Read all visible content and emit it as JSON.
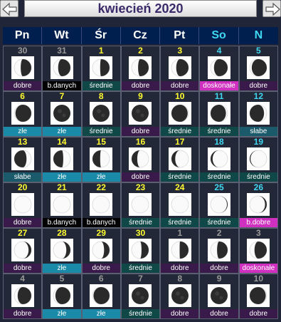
{
  "header": {
    "title": "kwiecień 2020",
    "prev_icon": "arrow-left-icon",
    "next_icon": "arrow-right-icon"
  },
  "weekdays": [
    "Pn",
    "Wt",
    "Śr",
    "Cz",
    "Pt",
    "So",
    "N"
  ],
  "colors": {
    "current_month_day": "#ffff30",
    "weekend_day": "#3fd8f0",
    "other_month_day": "#9a9a9a",
    "dobre": "#3a1a4a",
    "zle": "#1a8aa8",
    "srednie": "#104848",
    "slabe": "#1a5a6a",
    "b.danych": "#000000",
    "doskonale": "#d030c0"
  },
  "days": [
    {
      "day": "30",
      "kind": "other",
      "quality": "dobre",
      "moon_lit_fraction": 0.62,
      "waxing": true
    },
    {
      "day": "31",
      "kind": "other",
      "quality": "b.danych",
      "moon_lit_fraction": 0.72,
      "waxing": true
    },
    {
      "day": "1",
      "kind": "cur",
      "quality": "średnie",
      "moon_lit_fraction": 0.55,
      "waxing": true
    },
    {
      "day": "2",
      "kind": "cur",
      "quality": "dobre",
      "moon_lit_fraction": 0.62,
      "waxing": true
    },
    {
      "day": "3",
      "kind": "cur",
      "quality": "dobre",
      "moon_lit_fraction": 0.72,
      "waxing": true
    },
    {
      "day": "4",
      "kind": "wkend",
      "quality": "doskonałe",
      "moon_lit_fraction": 0.8,
      "waxing": true
    },
    {
      "day": "5",
      "kind": "wkend",
      "quality": "dobre",
      "moon_lit_fraction": 0.88,
      "waxing": true
    },
    {
      "day": "6",
      "kind": "cur",
      "quality": "złe",
      "moon_lit_fraction": 0.93,
      "waxing": true
    },
    {
      "day": "7",
      "kind": "cur",
      "quality": "złe",
      "moon_lit_fraction": 0.98,
      "waxing": true
    },
    {
      "day": "8",
      "kind": "cur",
      "quality": "średnie",
      "moon_lit_fraction": 1.0,
      "waxing": true
    },
    {
      "day": "9",
      "kind": "cur",
      "quality": "dobre",
      "moon_lit_fraction": 0.99,
      "waxing": false
    },
    {
      "day": "10",
      "kind": "cur",
      "quality": "średnie",
      "moon_lit_fraction": 0.95,
      "waxing": false
    },
    {
      "day": "11",
      "kind": "wkend",
      "quality": "średnie",
      "moon_lit_fraction": 0.9,
      "waxing": false
    },
    {
      "day": "12",
      "kind": "wkend",
      "quality": "słabe",
      "moon_lit_fraction": 0.84,
      "waxing": false
    },
    {
      "day": "13",
      "kind": "cur",
      "quality": "słabe",
      "moon_lit_fraction": 0.72,
      "waxing": false
    },
    {
      "day": "14",
      "kind": "cur",
      "quality": "złe",
      "moon_lit_fraction": 0.58,
      "waxing": false
    },
    {
      "day": "15",
      "kind": "cur",
      "quality": "złe",
      "moon_lit_fraction": 0.45,
      "waxing": false
    },
    {
      "day": "16",
      "kind": "cur",
      "quality": "dobre",
      "moon_lit_fraction": 0.33,
      "waxing": false
    },
    {
      "day": "17",
      "kind": "cur",
      "quality": "średnie",
      "moon_lit_fraction": 0.22,
      "waxing": false
    },
    {
      "day": "18",
      "kind": "wkend",
      "quality": "średnie",
      "moon_lit_fraction": 0.12,
      "waxing": false
    },
    {
      "day": "19",
      "kind": "wkend",
      "quality": "średnie",
      "moon_lit_fraction": 0.05,
      "waxing": false
    },
    {
      "day": "20",
      "kind": "cur",
      "quality": "dobre",
      "moon_lit_fraction": 0.0,
      "waxing": false
    },
    {
      "day": "21",
      "kind": "cur",
      "quality": "b.danych",
      "moon_lit_fraction": 0.0,
      "waxing": false
    },
    {
      "day": "22",
      "kind": "cur",
      "quality": "b.danych",
      "moon_lit_fraction": 0.0,
      "waxing": false
    },
    {
      "day": "23",
      "kind": "cur",
      "quality": "średnie",
      "moon_lit_fraction": 0.0,
      "waxing": true
    },
    {
      "day": "24",
      "kind": "cur",
      "quality": "średnie",
      "moon_lit_fraction": 0.0,
      "waxing": true
    },
    {
      "day": "25",
      "kind": "wkend",
      "quality": "średnie",
      "moon_lit_fraction": 0.04,
      "waxing": true
    },
    {
      "day": "26",
      "kind": "wkend",
      "quality": "b.dobre",
      "moon_lit_fraction": 0.1,
      "waxing": true
    },
    {
      "day": "27",
      "kind": "cur",
      "quality": "dobre",
      "moon_lit_fraction": 0.16,
      "waxing": true
    },
    {
      "day": "28",
      "kind": "cur",
      "quality": "złe",
      "moon_lit_fraction": 0.24,
      "waxing": true
    },
    {
      "day": "29",
      "kind": "cur",
      "quality": "dobre",
      "moon_lit_fraction": 0.32,
      "waxing": true
    },
    {
      "day": "30",
      "kind": "cur",
      "quality": "średnie",
      "moon_lit_fraction": 0.42,
      "waxing": true
    },
    {
      "day": "1",
      "kind": "other",
      "quality": "dobre",
      "moon_lit_fraction": 0.52,
      "waxing": true
    },
    {
      "day": "2",
      "kind": "other",
      "quality": "dobre",
      "moon_lit_fraction": 0.62,
      "waxing": true
    },
    {
      "day": "3",
      "kind": "other",
      "quality": "doskonałe",
      "moon_lit_fraction": 0.72,
      "waxing": true
    },
    {
      "day": "4",
      "kind": "other",
      "quality": "dobre",
      "moon_lit_fraction": 0.8,
      "waxing": true
    },
    {
      "day": "5",
      "kind": "other",
      "quality": "złe",
      "moon_lit_fraction": 0.88,
      "waxing": true
    },
    {
      "day": "6",
      "kind": "other",
      "quality": "złe",
      "moon_lit_fraction": 0.94,
      "waxing": true
    },
    {
      "day": "7",
      "kind": "other",
      "quality": "średnie",
      "moon_lit_fraction": 0.99,
      "waxing": true
    },
    {
      "day": "8",
      "kind": "other",
      "quality": "dobre",
      "moon_lit_fraction": 1.0,
      "waxing": true
    },
    {
      "day": "9",
      "kind": "other",
      "quality": "dobre",
      "moon_lit_fraction": 0.98,
      "waxing": false
    },
    {
      "day": "10",
      "kind": "other",
      "quality": "dobre",
      "moon_lit_fraction": 0.94,
      "waxing": false
    }
  ]
}
